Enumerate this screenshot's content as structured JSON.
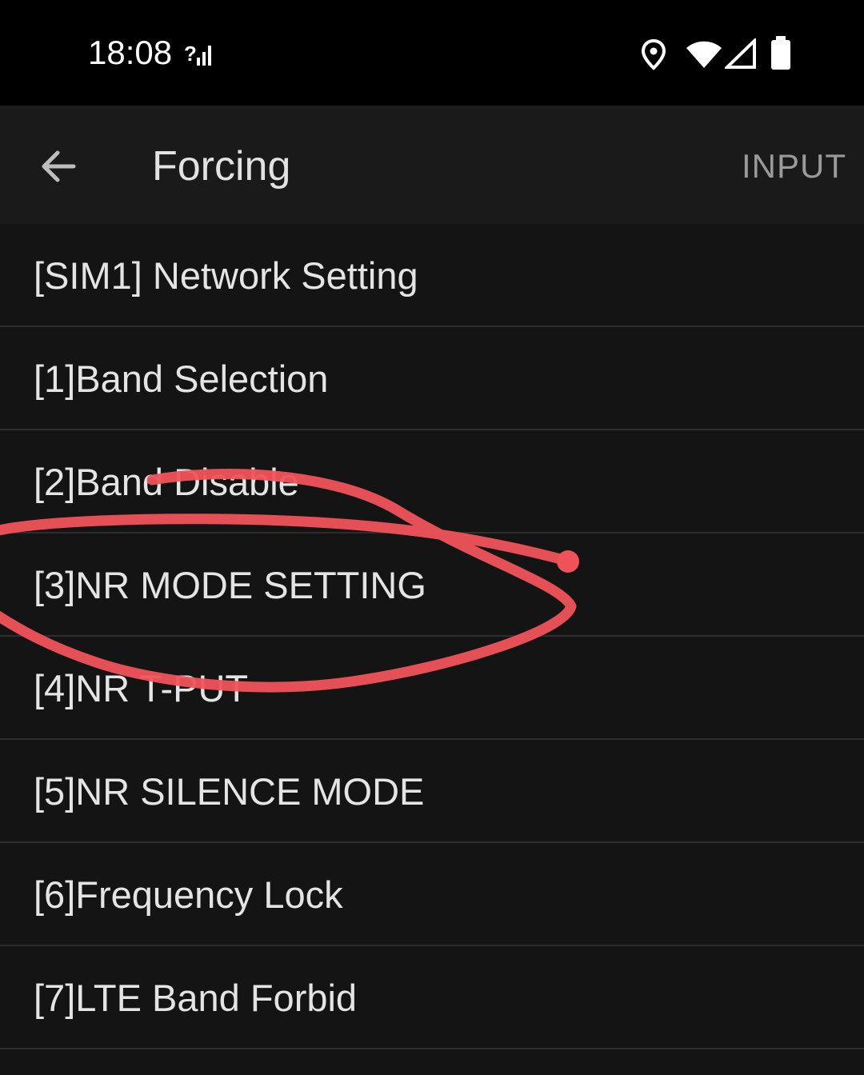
{
  "status_bar": {
    "time": "18:08",
    "icons": [
      "signal-unknown-icon",
      "location-icon",
      "wifi-icon",
      "cell-signal-icon",
      "battery-icon"
    ]
  },
  "app_bar": {
    "title": "Forcing",
    "action_label": "INPUT",
    "back_icon": "arrow-back-icon"
  },
  "menu": {
    "items": [
      {
        "label": "[SIM1] Network Setting"
      },
      {
        "label": "[1]Band Selection"
      },
      {
        "label": "[2]Band Disable"
      },
      {
        "label": "[3]NR MODE SETTING"
      },
      {
        "label": "[4]NR T-PUT"
      },
      {
        "label": "[5]NR SILENCE MODE"
      },
      {
        "label": "[6]Frequency Lock"
      },
      {
        "label": "[7]LTE Band Forbid"
      }
    ]
  },
  "colors": {
    "background": "#141414",
    "status_bar": "#000000",
    "app_bar": "#1a1a1a",
    "divider": "#2e2e2e",
    "text": "#e4e4e4",
    "action": "#9a9a9a",
    "annotation": "#f0525a"
  }
}
